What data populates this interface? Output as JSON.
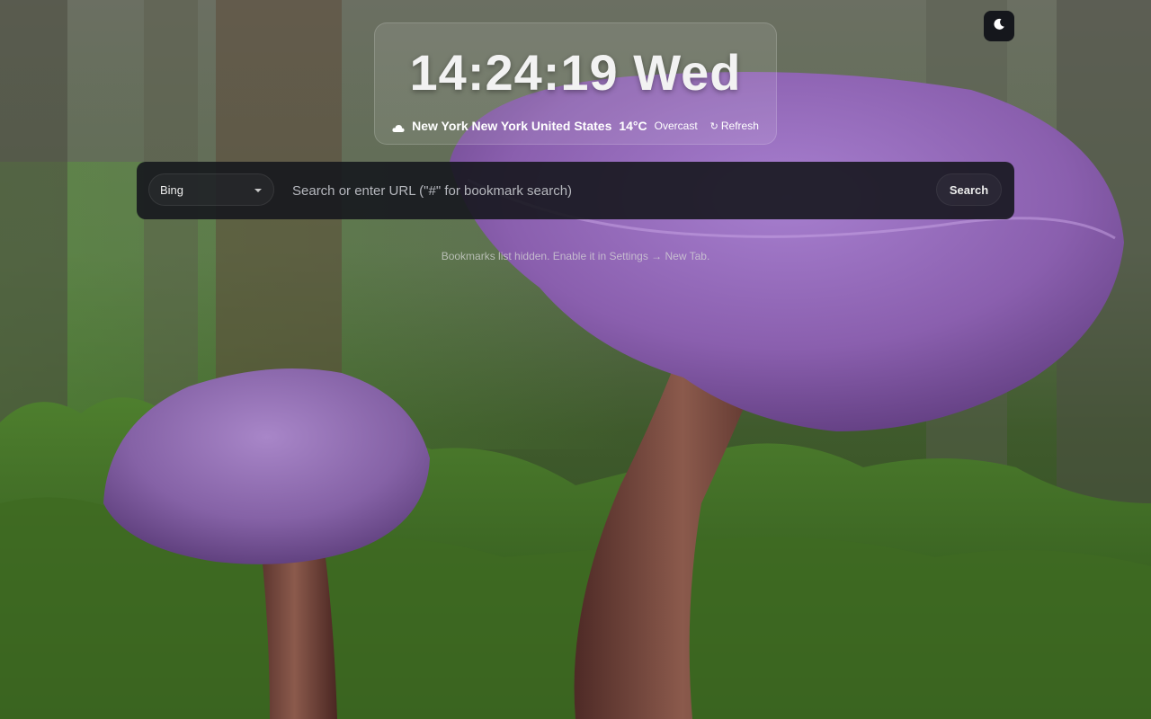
{
  "clock": {
    "time": "14:24:19 Wed"
  },
  "weather": {
    "icon": "cloud-icon",
    "location": "New York New York United States",
    "temperature": "14°C",
    "condition": "Overcast",
    "refresh_icon": "refresh-icon",
    "refresh_label": "Refresh"
  },
  "theme_toggle": {
    "icon": "moon-icon"
  },
  "search": {
    "engine": "Bing",
    "placeholder": "Search or enter URL (\"#\" for bookmark search)",
    "button_label": "Search"
  },
  "bookmarks": {
    "notice": "Bookmarks list hidden. Enable it in Settings → New Tab."
  },
  "background": {
    "description_colors": {
      "moss": "#3f6b2a",
      "mushroom_cap": "#8a5fae",
      "stem": "#6e4036",
      "forest": "#4d6a3f"
    }
  }
}
